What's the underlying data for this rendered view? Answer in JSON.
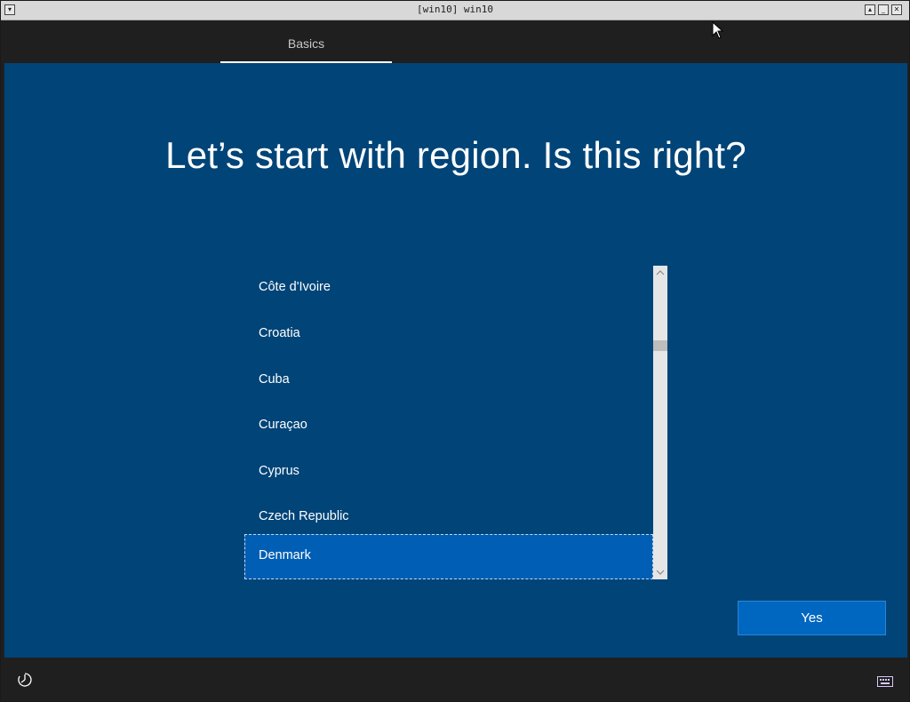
{
  "window": {
    "title": "[win10] win10"
  },
  "tabs": [
    {
      "label": "Basics"
    }
  ],
  "main": {
    "heading": "Let’s start with region. Is this right?",
    "regions": [
      "Côte d'Ivoire",
      "Croatia",
      "Cuba",
      "Curaçao",
      "Cyprus",
      "Czech Republic",
      "Denmark"
    ],
    "selected_region": "Denmark",
    "yes_label": "Yes"
  },
  "icons": {
    "ease_of_access": "ease-of-access-icon",
    "keyboard": "keyboard-icon",
    "scroll_up": "chevron-up-icon",
    "scroll_down": "chevron-down-icon"
  },
  "colors": {
    "background": "#004478",
    "selected_item": "#005fb4",
    "yes_button": "#0067c0",
    "bars": "#1f1f1f"
  }
}
